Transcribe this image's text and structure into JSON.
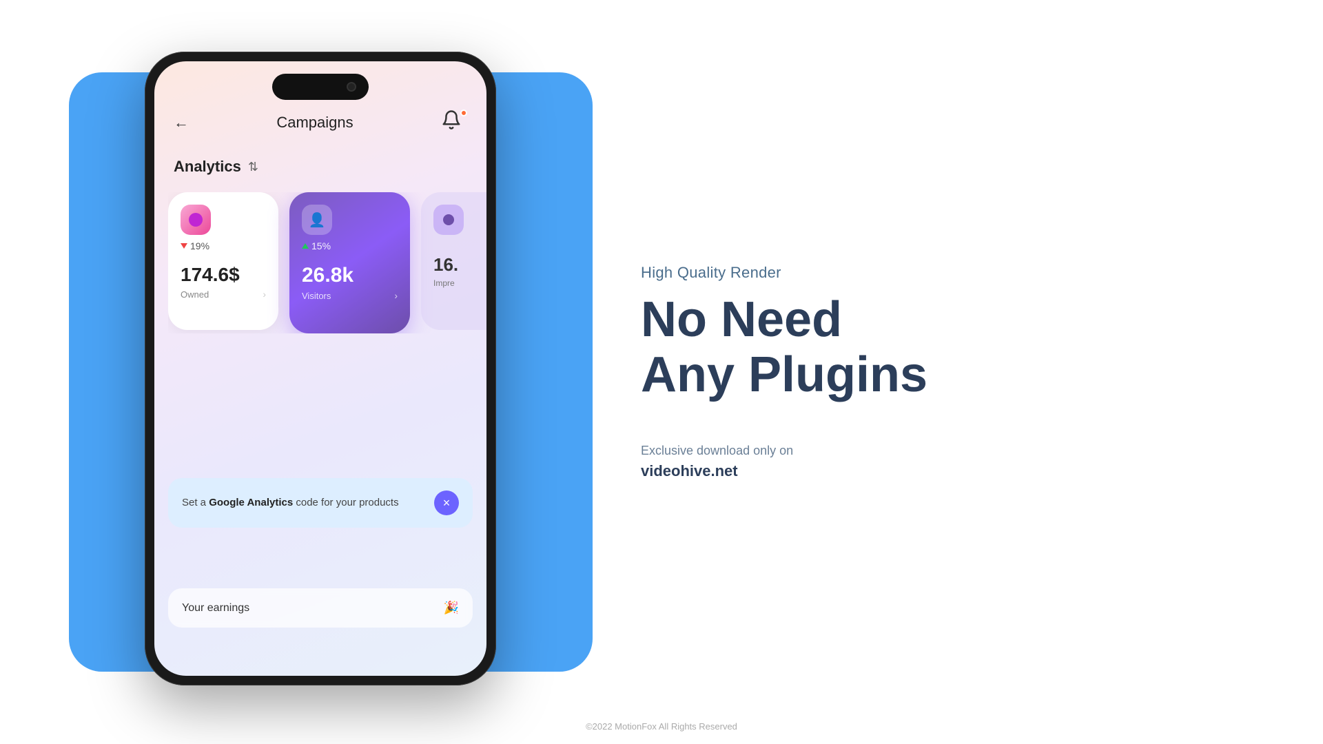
{
  "left": {
    "phone": {
      "header": {
        "title": "Campaigns",
        "back_label": "←",
        "bell_label": "🔔"
      },
      "analytics": {
        "label": "Analytics"
      },
      "cards": [
        {
          "id": "owned",
          "percent": "19%",
          "direction": "down",
          "value": "174.6$",
          "label": "Owned",
          "color": "white"
        },
        {
          "id": "visitors",
          "percent": "15%",
          "direction": "up",
          "value": "26.8k",
          "label": "Visitors",
          "color": "purple"
        },
        {
          "id": "impressions",
          "percent": "",
          "direction": "",
          "value": "16.",
          "label": "Impre",
          "color": "lavender"
        }
      ],
      "banner": {
        "text_prefix": "Set a ",
        "text_bold": "Google Analytics",
        "text_suffix": " code for your products",
        "close_label": "×"
      },
      "earnings": {
        "label": "Your earnings",
        "emoji": "🎉"
      }
    }
  },
  "right": {
    "tagline": "High Quality Render",
    "headline_line1": "No Need",
    "headline_line2": "Any Plugins",
    "download_info": "Exclusive download only on",
    "download_link": "videohive.net"
  },
  "footer": {
    "copyright": "©2022 MotionFox All Rights Reserved"
  }
}
